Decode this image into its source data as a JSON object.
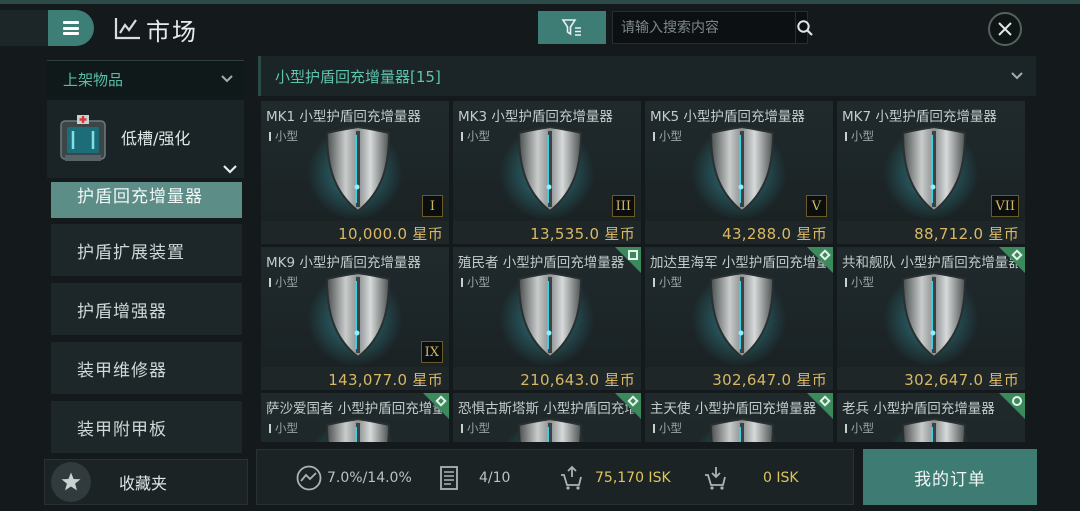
{
  "header": {
    "title": "市场",
    "search_placeholder": "请输入搜索内容"
  },
  "sidebar": {
    "listed_dropdown": "上架物品",
    "category": "低槽/强化",
    "items": [
      {
        "label": "护盾回充增量器",
        "active": true
      },
      {
        "label": "护盾扩展装置",
        "active": false
      },
      {
        "label": "护盾增强器",
        "active": false
      },
      {
        "label": "装甲维修器",
        "active": false
      },
      {
        "label": "装甲附甲板",
        "active": false
      }
    ],
    "favorites": "收藏夹"
  },
  "main": {
    "section_title": "小型护盾回充增量器[15]",
    "items": [
      {
        "name": "MK1 小型护盾回充增量器",
        "size": "小型",
        "tier": "I",
        "price": "10,000.0 星币",
        "badge": ""
      },
      {
        "name": "MK3 小型护盾回充增量器",
        "size": "小型",
        "tier": "III",
        "price": "13,535.0 星币",
        "badge": ""
      },
      {
        "name": "MK5 小型护盾回充增量器",
        "size": "小型",
        "tier": "V",
        "price": "43,288.0 星币",
        "badge": ""
      },
      {
        "name": "MK7 小型护盾回充增量器",
        "size": "小型",
        "tier": "VII",
        "price": "88,712.0 星币",
        "badge": ""
      },
      {
        "name": "MK9 小型护盾回充增量器",
        "size": "小型",
        "tier": "IX",
        "price": "143,077.0 星币",
        "badge": ""
      },
      {
        "name": "殖民者 小型护盾回充增量器",
        "size": "小型",
        "tier": "",
        "price": "210,643.0 星币",
        "badge": "square"
      },
      {
        "name": "加达里海军 小型护盾回充增量器",
        "size": "小型",
        "tier": "",
        "price": "302,647.0 星币",
        "badge": "diamond"
      },
      {
        "name": "共和舰队 小型护盾回充增量器",
        "size": "小型",
        "tier": "",
        "price": "302,647.0 星币",
        "badge": "diamond"
      },
      {
        "name": "萨沙爱国者 小型护盾回充增量器",
        "size": "小型",
        "tier": "",
        "price": "",
        "badge": "diamond"
      },
      {
        "name": "恐惧古斯塔斯 小型护盾回充增量器",
        "size": "小型",
        "tier": "",
        "price": "",
        "badge": "diamond"
      },
      {
        "name": "主天使 小型护盾回充增量器",
        "size": "小型",
        "tier": "",
        "price": "",
        "badge": "diamond"
      },
      {
        "name": "老兵 小型护盾回充增量器",
        "size": "小型",
        "tier": "",
        "price": "",
        "badge": "square"
      }
    ]
  },
  "footer": {
    "tax": "7.0%/14.0%",
    "orders": "4/10",
    "balance": "75,170 ISK",
    "escrow": "0 ISK",
    "my_orders_button": "我的订单"
  },
  "colors": {
    "accent": "#3e7b73",
    "price": "#d8b864",
    "heading_teal": "#5ec4ad",
    "badge_green": "#3a8a5c"
  }
}
